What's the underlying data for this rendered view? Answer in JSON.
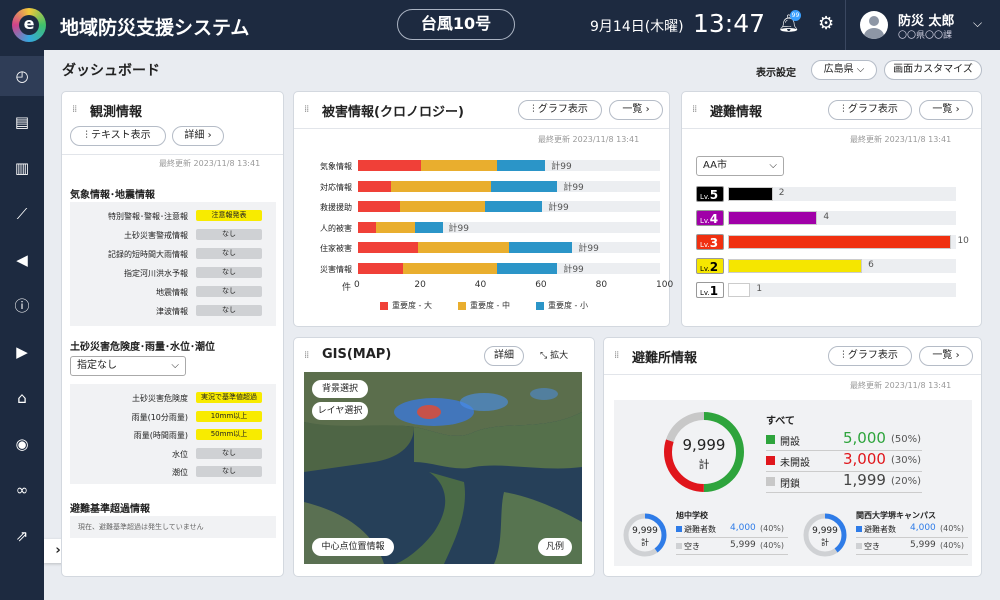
{
  "header": {
    "app_title": "地域防災支援システム",
    "typhoon": "台風10号",
    "date": "9月14日(木曜)",
    "time": "13:47",
    "notif_count": "99",
    "user_name": "防災 太郎",
    "user_dept": "〇〇県〇〇課"
  },
  "page": {
    "title": "ダッシュボード",
    "settings_label": "表示設定",
    "region": "広島県 ⌵",
    "customize": "画面カスタマイズ"
  },
  "observation": {
    "title": "観測情報",
    "text_btn": "テキスト表示",
    "detail_btn": "詳細 ›",
    "updated": "最終更新 2023/11/8 13:41",
    "sec1": "気象情報･地震情報",
    "rows1": [
      {
        "label": "特別警報･警報･注意報",
        "value": "注意報発表",
        "color": "#f8eb00"
      },
      {
        "label": "土砂災害警戒情報",
        "value": "なし",
        "color": "#cfd1d4"
      },
      {
        "label": "記録的短時間大雨情報",
        "value": "なし",
        "color": "#cfd1d4"
      },
      {
        "label": "指定河川洪水予報",
        "value": "なし",
        "color": "#cfd1d4"
      },
      {
        "label": "地震情報",
        "value": "なし",
        "color": "#cfd1d4"
      },
      {
        "label": "津波情報",
        "value": "なし",
        "color": "#cfd1d4"
      }
    ],
    "sec2": "土砂災害危険度･雨量･水位･潮位",
    "select": "指定なし",
    "rows2": [
      {
        "label": "土砂災害危険度",
        "value": "実況で基準値超過",
        "color": "#f8eb00"
      },
      {
        "label": "雨量(10分雨量)",
        "value": "10mm以上",
        "color": "#f8eb00"
      },
      {
        "label": "雨量(時間雨量)",
        "value": "50mm以上",
        "color": "#f8eb00"
      },
      {
        "label": "水位",
        "value": "なし",
        "color": "#cfd1d4"
      },
      {
        "label": "潮位",
        "value": "なし",
        "color": "#cfd1d4"
      }
    ],
    "sec3": "避難基準超過情報",
    "sec3_text": "現在、避難基準超過は発生していません"
  },
  "damage": {
    "title": "被害情報(クロノロジー)",
    "graph_btn": "グラフ表示",
    "list_btn": "一覧 ›",
    "updated": "最終更新 2023/11/8 13:41",
    "axis_unit": "件",
    "legend": [
      "重要度 - 大",
      "重要度 - 中",
      "重要度 - 小"
    ],
    "colors": [
      "#f04038",
      "#e9ae2e",
      "#2b95c8"
    ],
    "xticks": [
      "0",
      "20",
      "40",
      "60",
      "80",
      "100"
    ]
  },
  "chart_data": {
    "type": "bar",
    "orientation": "horizontal",
    "stacked": true,
    "categories": [
      "気象情報",
      "対応情報",
      "救援援助",
      "人的被害",
      "住家被害",
      "災害情報"
    ],
    "series": [
      {
        "name": "重要度 - 大",
        "values": [
          21,
          11,
          14,
          6,
          20,
          15
        ]
      },
      {
        "name": "重要度 - 中",
        "values": [
          25,
          33,
          28,
          13,
          30,
          31
        ]
      },
      {
        "name": "重要度 - 小",
        "values": [
          16,
          22,
          19,
          9,
          21,
          20
        ]
      }
    ],
    "totals": [
      "計99",
      "計99",
      "計99",
      "計99",
      "計99",
      "計99"
    ],
    "xlabel": "件",
    "xlim": [
      0,
      100
    ],
    "grid": false,
    "legend_position": "bottom"
  },
  "evac": {
    "title": "避難情報",
    "graph_btn": "グラフ表示",
    "list_btn": "一覧 ›",
    "updated": "最終更新 2023/11/8 13:41",
    "city": "AA市",
    "levels": [
      {
        "lv": "Lv.",
        "num": "5",
        "count": 2,
        "color": "#000000",
        "lblbg": "#000000",
        "lblfg": "#ffffff"
      },
      {
        "lv": "Lv.",
        "num": "4",
        "count": 4,
        "color": "#a000a8",
        "lblbg": "#a000a8",
        "lblfg": "#ffffff"
      },
      {
        "lv": "Lv.",
        "num": "3",
        "count": 10,
        "color": "#f03010",
        "lblbg": "#f03010",
        "lblfg": "#ffffff"
      },
      {
        "lv": "Lv.",
        "num": "2",
        "count": 6,
        "color": "#f5e600",
        "lblbg": "#f5e600",
        "lblfg": "#000000"
      },
      {
        "lv": "Lv.",
        "num": "1",
        "count": 1,
        "color": "#ffffff",
        "lblbg": "#ffffff",
        "lblfg": "#000000"
      }
    ]
  },
  "gis": {
    "title": "GIS(MAP)",
    "detail_btn": "詳細",
    "expand": "拡大",
    "bg_select": "背景選択",
    "layer_select": "レイヤ選択",
    "center": "中心点位置情報",
    "legend": "凡例"
  },
  "shelter": {
    "title": "避難所情報",
    "graph_btn": "グラフ表示",
    "list_btn": "一覧 ›",
    "updated": "最終更新 2023/11/8 13:41",
    "total": "9,999",
    "total_unit": "計",
    "all": "すべて",
    "status": [
      {
        "label": "開設",
        "value": "5,000",
        "pct": "(50%)",
        "color": "#2ea43c",
        "frac": 0.5
      },
      {
        "label": "未開設",
        "value": "3,000",
        "pct": "(30%)",
        "color": "#e0161c",
        "frac": 0.3
      },
      {
        "label": "閉鎖",
        "value": "1,999",
        "pct": "(20%)",
        "color": "#c8c8c8",
        "frac": 0.2
      }
    ],
    "facilities": [
      {
        "name": "旭中学校",
        "total": "9,999",
        "unit": "計",
        "r1": "避難者数",
        "v1": "4,000",
        "p1": "(40%)",
        "r2": "空き",
        "v2": "5,999",
        "p2": "(40%)",
        "frac": 0.4
      },
      {
        "name": "関西大学堺キャンパス",
        "total": "9,999",
        "unit": "計",
        "r1": "避難者数",
        "v1": "4,000",
        "p1": "(40%)",
        "r2": "空き",
        "v2": "5,999",
        "p2": "(40%)",
        "frac": 0.4
      }
    ]
  }
}
